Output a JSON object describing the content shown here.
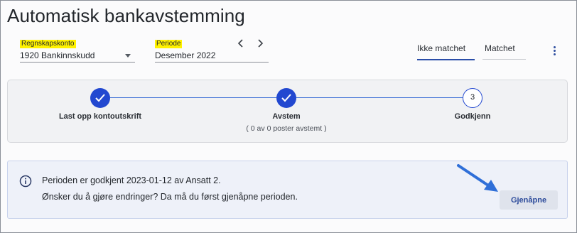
{
  "page": {
    "title": "Automatisk bankavstemming"
  },
  "filters": {
    "account": {
      "label": "Regnskapskonto",
      "value": "1920 Bankinnskudd",
      "icon": "chevron-down-icon"
    },
    "period": {
      "label": "Periode",
      "value": "Desember 2022",
      "prev_icon": "chevron-left-icon",
      "next_icon": "chevron-right-icon"
    }
  },
  "tabs": [
    {
      "label": "Ikke matchet",
      "active": true
    },
    {
      "label": "Matchet",
      "active": false
    }
  ],
  "menu": {
    "icon": "more-vertical-icon"
  },
  "stepper": {
    "steps": [
      {
        "label": "Last opp kontoutskrift",
        "status": "done",
        "sub": ""
      },
      {
        "label": "Avstem",
        "status": "done",
        "sub": "( 0 av 0 poster avstemt )"
      },
      {
        "label": "Godkjenn",
        "status": "pending",
        "number": "3",
        "sub": ""
      }
    ]
  },
  "info": {
    "icon": "info-icon",
    "line1": "Perioden er godkjent 2023-01-12 av Ansatt 2.",
    "line2": "Ønsker du å gjøre endringer? Da må du først gjenåpne perioden.",
    "button_label": "Gjenåpne"
  },
  "colors": {
    "accent": "#2248d0",
    "highlight": "#fff200",
    "annotation_arrow": "#2f6fd8"
  }
}
